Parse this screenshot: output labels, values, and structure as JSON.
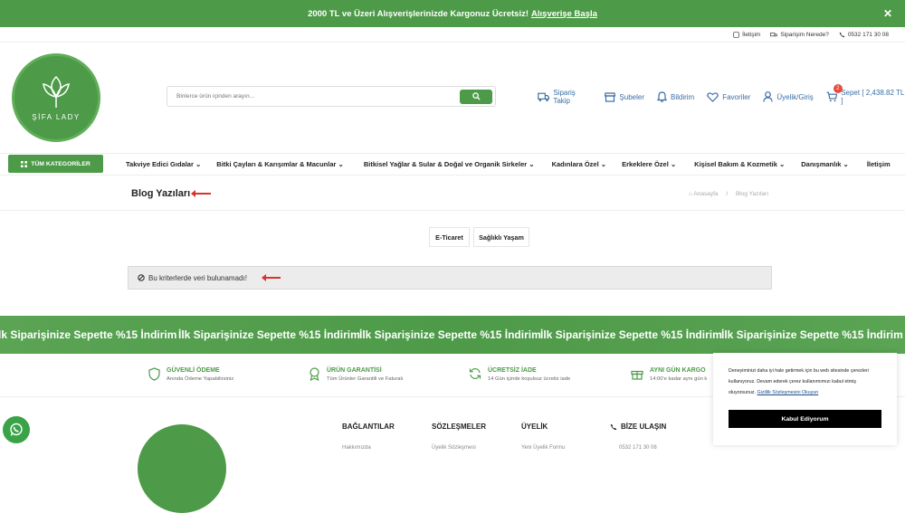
{
  "announcement": {
    "text": "2000 TL ve Üzeri Alışverişlerinizde Kargonuz Ücretsiz!",
    "link": "Alışverişe Başla",
    "close": "✕"
  },
  "topbar": {
    "contact": "İletişim",
    "order_where": "Siparişim Nerede?",
    "phone": "0532 171 30 08"
  },
  "logo": {
    "text": "ŞİFA LADY"
  },
  "search": {
    "placeholder": "Binlerce ürün içinden arayın..."
  },
  "header_nav": {
    "order_track": "Sipariş Takip",
    "branches": "Şubeler",
    "notify": "Bildirim",
    "favorites": "Favoriler",
    "account": "Üyelik/Giriş",
    "cart_count": "2",
    "cart": "Sepet [ 2,438.82 TL ]"
  },
  "categories": {
    "all": "TÜM KATEGORİLER",
    "items": [
      "Takviye Edici Gıdalar",
      "Bitki Çayları & Karışımlar & Macunlar",
      "Bitkisel Yağlar & Sular & Doğal ve Organik Sirkeler",
      "Kadınlara Özel",
      "Erkeklere Özel",
      "Kişisel Bakım & Kozmetik",
      "Danışmanlık",
      "İletişim"
    ]
  },
  "page": {
    "title": "Blog Yazıları",
    "breadcrumb_home": "Anasayfa",
    "breadcrumb_sep": "/",
    "breadcrumb_current": "Blog Yazıları"
  },
  "tabs": [
    "E-Ticaret",
    "Sağlıklı Yaşam"
  ],
  "alert": {
    "text": "Bu kriterlerde veri bulunamadı!"
  },
  "marquee": {
    "text": "İlk Siparişinize Sepette %15 İndirim",
    "partial": "lk Siparişinize Sepette %15 İndirim"
  },
  "features": [
    {
      "title": "GÜVENLİ ÖDEME",
      "sub": "Anında Ödeme Yapabilirsiniz"
    },
    {
      "title": "ÜRÜN GARANTİSİ",
      "sub": "Tüm Ürünler Garantili ve Faturalı"
    },
    {
      "title": "ÜCRETSİZ İADE",
      "sub": "14 Gün içinde koşulsuz ücretiz iade"
    },
    {
      "title": "AYNI GÜN KARGO",
      "sub": "14:00'e kadar aynı gün k"
    }
  ],
  "footer": {
    "titles": [
      "BAĞLANTILAR",
      "SÖZLEŞMELER",
      "ÜYELİK",
      "BİZE ULAŞIN"
    ],
    "links": [
      "Hakkımızda",
      "Üyelik Sözleşmesi",
      "Yeni Üyelik Formu",
      "0532 171 30 08"
    ]
  },
  "cookie": {
    "text": "Deneyiminizi daha iyi hale getirmek için bu web sitesinde çerezleri kullanıyoruz. Devam ederek çerez kullanımımızı kabul etmiş oluyorsunuz.",
    "link": "Gizlilik Sözleşmesini Okuyun",
    "button": "Kabul Ediyorum"
  },
  "colors": {
    "brand_green": "#4d9a48",
    "alert_red": "#d9342b"
  }
}
